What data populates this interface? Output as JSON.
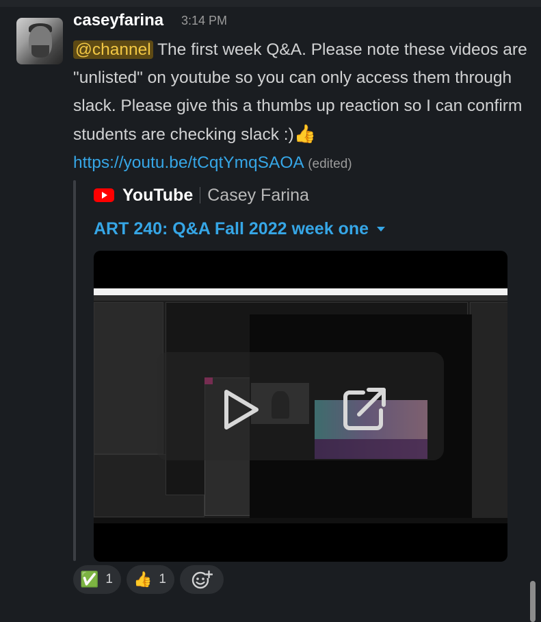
{
  "message": {
    "author": "caseyfarina",
    "time": "3:14 PM",
    "mention": "@channel",
    "text_part1": " The first week Q&A. Please note these videos are \"unlisted\" on youtube so you can only access them through slack. Please give this a thumbs up reaction so I can confirm students are checking slack :)",
    "text_emoji": "👍",
    "link": "https://youtu.be/tCqtYmqSAOA",
    "edited": "(edited)"
  },
  "attachment": {
    "service": "YouTube",
    "channel": "Casey Farina",
    "title": "ART 240: Q&A Fall 2022 week one"
  },
  "reactions": [
    {
      "emoji": "✅",
      "count": "1",
      "icon": "check-mark-emoji"
    },
    {
      "emoji": "👍",
      "count": "1",
      "icon": "thumbs-up-emoji"
    }
  ],
  "add_reaction": {
    "icon": "add-reaction-icon"
  },
  "colors": {
    "background": "#1a1d21",
    "link": "#36a6e6",
    "mention_bg": "#5e4a14",
    "mention_text": "#f2c744"
  }
}
